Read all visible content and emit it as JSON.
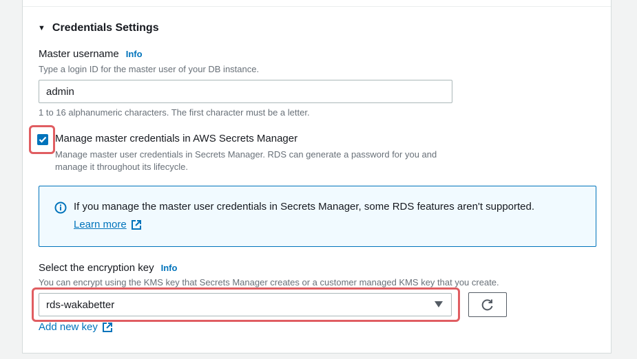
{
  "section": {
    "title": "Credentials Settings"
  },
  "username": {
    "label": "Master username",
    "info": "Info",
    "description": "Type a login ID for the master user of your DB instance.",
    "value": "admin",
    "constraint": "1 to 16 alphanumeric characters. The first character must be a letter."
  },
  "manage_credentials": {
    "checked": true,
    "label": "Manage master credentials in AWS Secrets Manager",
    "description": "Manage master user credentials in Secrets Manager. RDS can generate a password for you and manage it throughout its lifecycle."
  },
  "alert": {
    "text": "If you manage the master user credentials in Secrets Manager, some RDS features aren't supported.",
    "link": "Learn more"
  },
  "encryption_key": {
    "label": "Select the encryption key",
    "info": "Info",
    "description": "You can encrypt using the KMS key that Secrets Manager creates or a customer managed KMS key that you create.",
    "selected": "rds-wakabetter",
    "add_key": "Add new key"
  },
  "colors": {
    "link": "#0073bb",
    "highlight": "#e05d61",
    "alert_bg": "#f1faff"
  },
  "icons": [
    "caret-down-icon",
    "checkmark-icon",
    "info-icon",
    "external-link-icon",
    "dropdown-caret-icon",
    "refresh-icon"
  ]
}
